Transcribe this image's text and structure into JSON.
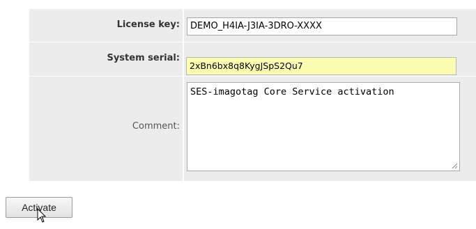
{
  "form": {
    "license": {
      "label": "License key:",
      "value": "DEMO_H4IA-J3IA-3DRO-XXXX"
    },
    "serial": {
      "label": "System serial:",
      "value": "2xBn6bx8q8KygJSpS2Qu7"
    },
    "comment": {
      "label": "Comment:",
      "value": "SES-imagotag Core Service activation"
    }
  },
  "actions": {
    "activate_label": "Activate"
  },
  "colors": {
    "panel_bg": "#ececec",
    "serial_highlight": "#fdfdb2"
  },
  "icons": {
    "resize": "resize-grip-icon",
    "pointer": "mouse-pointer-icon"
  }
}
